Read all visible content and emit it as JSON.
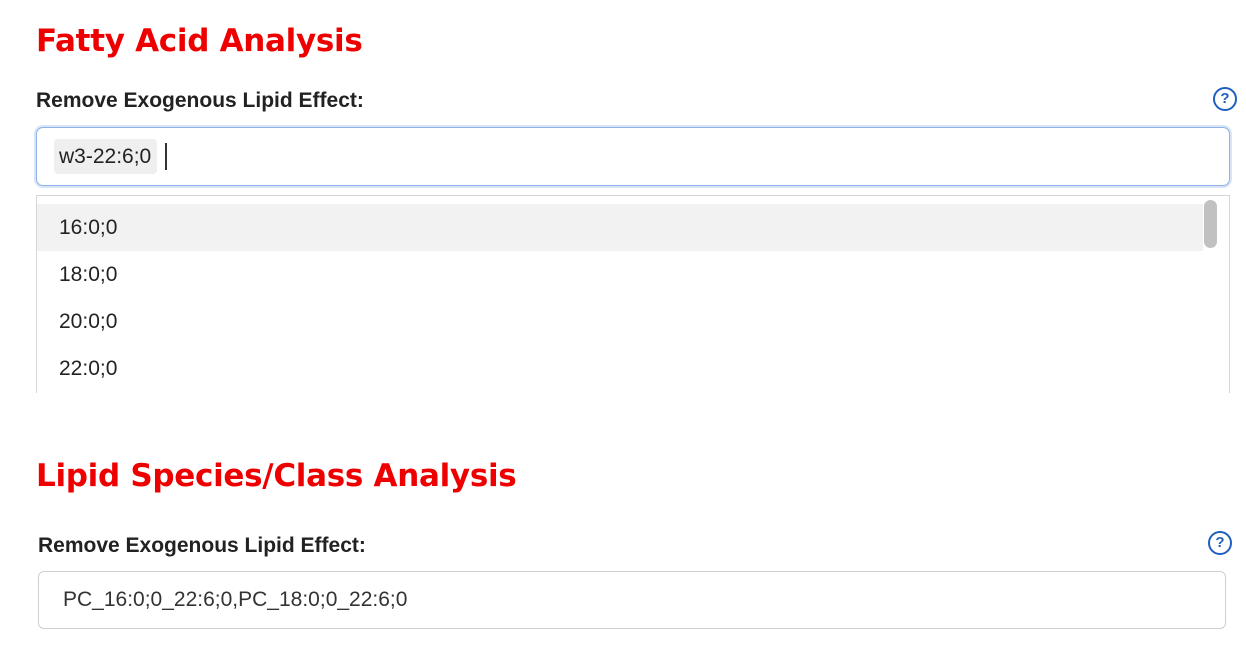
{
  "fatty_acid_section": {
    "title": "Fatty Acid Analysis",
    "field_label": "Remove Exogenous Lipid Effect:",
    "help_icon": "question-circle-icon",
    "selected_chip": "w3-22:6;0",
    "dropdown_options": [
      "16:0;0",
      "18:0;0",
      "20:0;0",
      "22:0;0"
    ],
    "highlighted_option": "16:0;0"
  },
  "lipid_species_section": {
    "title": "Lipid Species/Class Analysis",
    "field_label": "Remove Exogenous Lipid Effect:",
    "help_icon": "question-circle-icon",
    "input_value": "PC_16:0;0_22:6;0,PC_18:0;0_22:6;0"
  },
  "colors": {
    "section_title": "#ee0000",
    "help_icon": "#1f5fbf",
    "focus_border": "#8fb2e6",
    "highlight_row": "#f2f2f2"
  }
}
